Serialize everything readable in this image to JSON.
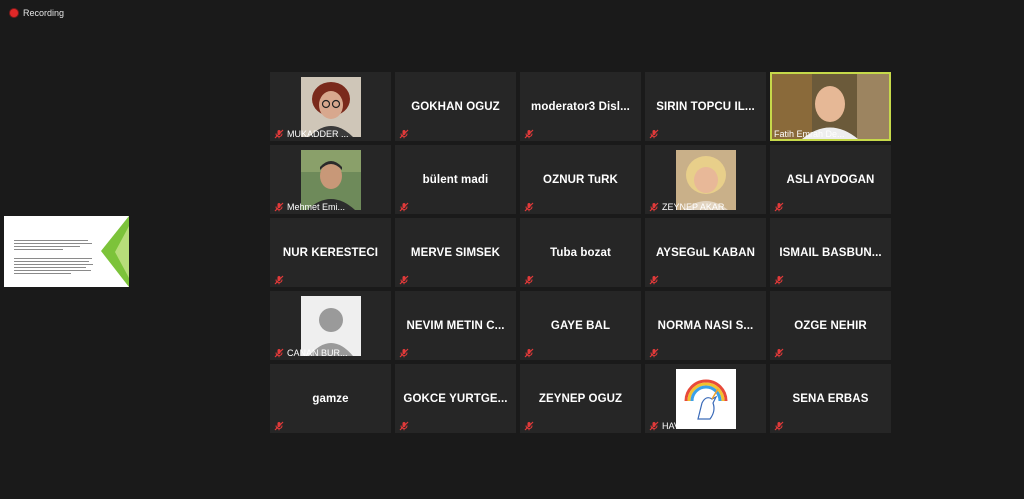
{
  "recording": {
    "label": "Recording"
  },
  "participants": [
    {
      "name": "MUKADDER ...",
      "photo": "woman-glasses-avatar",
      "muted": true
    },
    {
      "name": "GOKHAN OGUZ",
      "muted": true
    },
    {
      "name": "moderator3 Disl...",
      "muted": true
    },
    {
      "name": "SIRIN TOPCU IL...",
      "muted": true
    },
    {
      "name": "Fatih Emrah De...",
      "photo": "man-video-feed",
      "muted": false,
      "active": true
    },
    {
      "name": "Mehmet Emi...",
      "photo": "man-avatar",
      "muted": true
    },
    {
      "name": "bülent madi",
      "muted": true
    },
    {
      "name": "OZNUR TuRK",
      "muted": true
    },
    {
      "name": "ZEYNEP AKAR",
      "photo": "woman-blonde-avatar",
      "muted": true
    },
    {
      "name": "ASLI AYDOGAN",
      "muted": true
    },
    {
      "name": "NUR KERESTECI",
      "muted": true
    },
    {
      "name": "MERVE SIMSEK",
      "muted": true
    },
    {
      "name": "Tuba bozat",
      "muted": true
    },
    {
      "name": "AYSEGuL KABAN",
      "muted": true
    },
    {
      "name": "ISMAIL BASBUN...",
      "muted": true
    },
    {
      "name": "CANAN BUR...",
      "photo": "default-user-avatar",
      "muted": true
    },
    {
      "name": "NEVIM METIN C...",
      "muted": true
    },
    {
      "name": "GAYE BAL",
      "muted": true
    },
    {
      "name": "NORMA NASI S...",
      "muted": true
    },
    {
      "name": "OZGE NEHIR",
      "muted": true
    },
    {
      "name": "gamze",
      "muted": true
    },
    {
      "name": "GOKCE YURTGE...",
      "muted": true
    },
    {
      "name": "ZEYNEP OGUZ",
      "muted": true
    },
    {
      "name": "HAVVA NARS...",
      "photo": "unicorn-avatar",
      "muted": true
    },
    {
      "name": "SENA ERBAS",
      "muted": true
    }
  ],
  "colors": {
    "muted_icon": "#e23a3a",
    "active_border": "#c6d94a",
    "tile_bg": "#262626"
  }
}
